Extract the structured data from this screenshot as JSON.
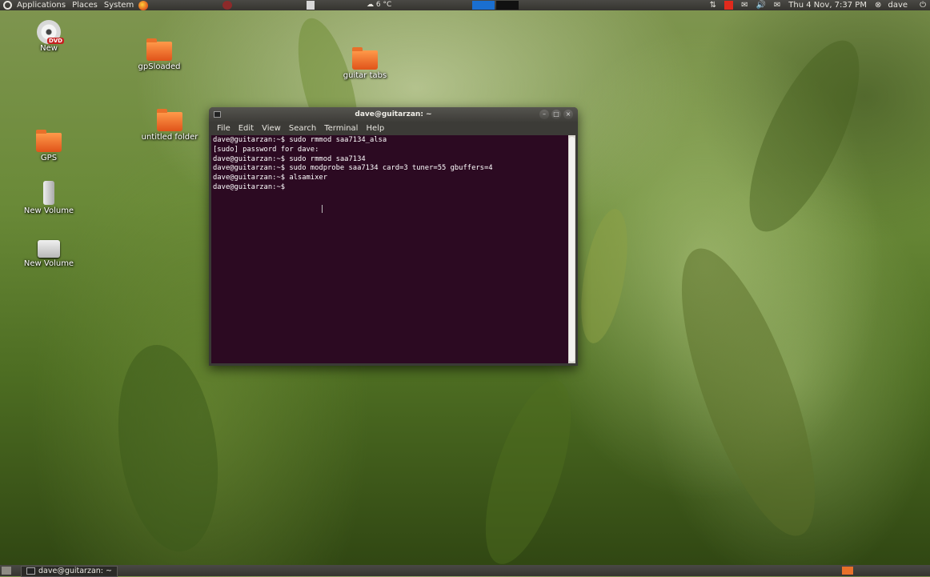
{
  "top_panel": {
    "menus": [
      "Applications",
      "Places",
      "System"
    ],
    "weather": "6 °C",
    "clock": "Thu 4 Nov, 7:37 PM",
    "user": "dave"
  },
  "desktop_icons": [
    {
      "label": "New",
      "kind": "dvd",
      "badge": "DVD"
    },
    {
      "label": "gpSloaded",
      "kind": "folder"
    },
    {
      "label": "guitar tabs",
      "kind": "folder"
    },
    {
      "label": "untitled folder",
      "kind": "folder"
    },
    {
      "label": "GPS",
      "kind": "folder"
    },
    {
      "label": "New Volume",
      "kind": "usb"
    },
    {
      "label": "New Volume",
      "kind": "drive"
    }
  ],
  "terminal": {
    "title": "dave@guitarzan: ~",
    "menu": [
      "File",
      "Edit",
      "View",
      "Search",
      "Terminal",
      "Help"
    ],
    "lines": [
      "dave@guitarzan:~$ sudo rmmod saa7134_alsa",
      "[sudo] password for dave:",
      "dave@guitarzan:~$ sudo rmmod saa7134",
      "dave@guitarzan:~$ sudo modprobe saa7134 card=3 tuner=55 gbuffers=4",
      "dave@guitarzan:~$ alsamixer",
      "dave@guitarzan:~$ "
    ]
  },
  "taskbar": {
    "window_label": "dave@guitarzan: ~"
  }
}
